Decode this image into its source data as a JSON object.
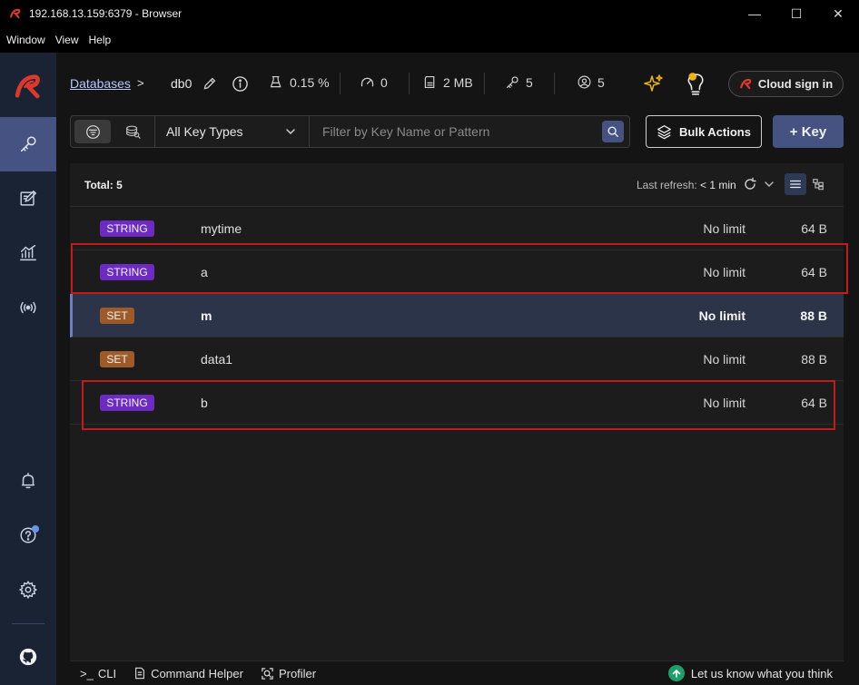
{
  "window": {
    "title": "192.168.13.159:6379 - Browser",
    "controls": {
      "minimize": "—",
      "maximize": "☐",
      "close": "✕"
    }
  },
  "menu": [
    "Window",
    "View",
    "Help"
  ],
  "sidebar": {
    "items": [
      {
        "name": "browser",
        "icon": "key-icon",
        "active": true
      },
      {
        "name": "workbench",
        "icon": "edit-icon",
        "active": false
      },
      {
        "name": "analysis",
        "icon": "chart-icon",
        "active": false
      },
      {
        "name": "pubsub",
        "icon": "broadcast-icon",
        "active": false
      }
    ],
    "bottom": [
      {
        "name": "notifications",
        "icon": "bell-icon"
      },
      {
        "name": "help",
        "icon": "help-icon"
      },
      {
        "name": "settings",
        "icon": "gear-icon"
      },
      {
        "name": "github",
        "icon": "github-icon"
      }
    ]
  },
  "header": {
    "breadcrumb": "Databases",
    "separator": ">",
    "db_name": "db0",
    "cpu": "0.15 %",
    "ops": "0",
    "memory": "2 MB",
    "keys": "5",
    "clients": "5",
    "cloud_sign_in": "Cloud sign in"
  },
  "filter": {
    "key_type": "All Key Types",
    "search_placeholder": "Filter by Key Name or Pattern",
    "search_value": "",
    "bulk_actions": "Bulk Actions",
    "add_key": "+ Key"
  },
  "panel": {
    "total": "Total: 5",
    "last_refresh_label": "Last refresh:",
    "last_refresh_value": "< 1 min"
  },
  "keys": [
    {
      "type": "STRING",
      "name": "mytime",
      "ttl": "No limit",
      "size": "64 B"
    },
    {
      "type": "STRING",
      "name": "a",
      "ttl": "No limit",
      "size": "64 B"
    },
    {
      "type": "SET",
      "name": "m",
      "ttl": "No limit",
      "size": "88 B"
    },
    {
      "type": "SET",
      "name": "data1",
      "ttl": "No limit",
      "size": "88 B"
    },
    {
      "type": "STRING",
      "name": "b",
      "ttl": "No limit",
      "size": "64 B"
    }
  ],
  "bottom_bar": {
    "cli": "CLI",
    "cli_prompt": ">_",
    "command_helper": "Command Helper",
    "profiler": "Profiler",
    "feedback": "Let us know what you think"
  },
  "colors": {
    "accent": "#465282",
    "string_badge": "#6e2bc2",
    "set_badge": "#9e5a28",
    "highlight": "#c41a1a",
    "brand_red": "#dc382c"
  }
}
